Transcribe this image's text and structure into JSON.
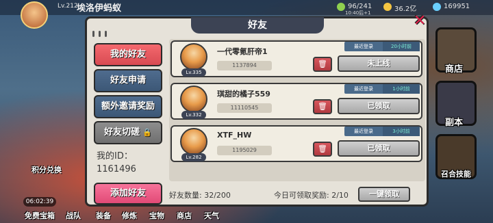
{
  "hud": {
    "player_level": "Lv.212",
    "player_name": "埃洛伊蚂蚁",
    "stamina": "96/241",
    "gold": "36.2亿",
    "gems": "169951",
    "timer_small": "10:40后+1"
  },
  "side_menu": {
    "shop": "商店",
    "dungeon": "副本",
    "combo": "召合技能"
  },
  "left_menu": {
    "points": "积分兑换",
    "timer": "06:02:39",
    "treasure": "免费宝箱"
  },
  "bottom_nav": [
    "战队",
    "装备",
    "修炼",
    "宝物",
    "商店",
    "天气"
  ],
  "dialog": {
    "title": "好友",
    "close_label": "✕"
  },
  "tabs": {
    "my_friends": "我的好友",
    "friend_requests": "好友申请",
    "extra_invite": "额外邀请奖励",
    "friend_spar": "好友切磋",
    "my_id_label": "我的ID：",
    "my_id_value": "1161496",
    "add_friend": "添加好友"
  },
  "friends": [
    {
      "level": "Lv.335",
      "name": "一代零氪肝帝1",
      "id": "1137894",
      "login_label": "最近登录",
      "login_time": "20小时前",
      "status": "未上线"
    },
    {
      "level": "Lv.332",
      "name": "琪甜的橘子559",
      "id": "11110545",
      "login_label": "最近登录",
      "login_time": "1小时前",
      "status": "已领取"
    },
    {
      "level": "Lv.282",
      "name": "XTF_HW",
      "id": "1195029",
      "login_label": "最近登录",
      "login_time": "3小时前",
      "status": "已领取"
    }
  ],
  "footer": {
    "friend_count": "好友数量: 32/200",
    "claim_today": "今日可领取奖励: 2/10",
    "one_key_claim": "一键领取"
  },
  "colors": {
    "tab_active": "#e0545c",
    "tab_normal": "#4a6688",
    "add_button": "#ec5d86",
    "close_x": "#e0204a"
  }
}
